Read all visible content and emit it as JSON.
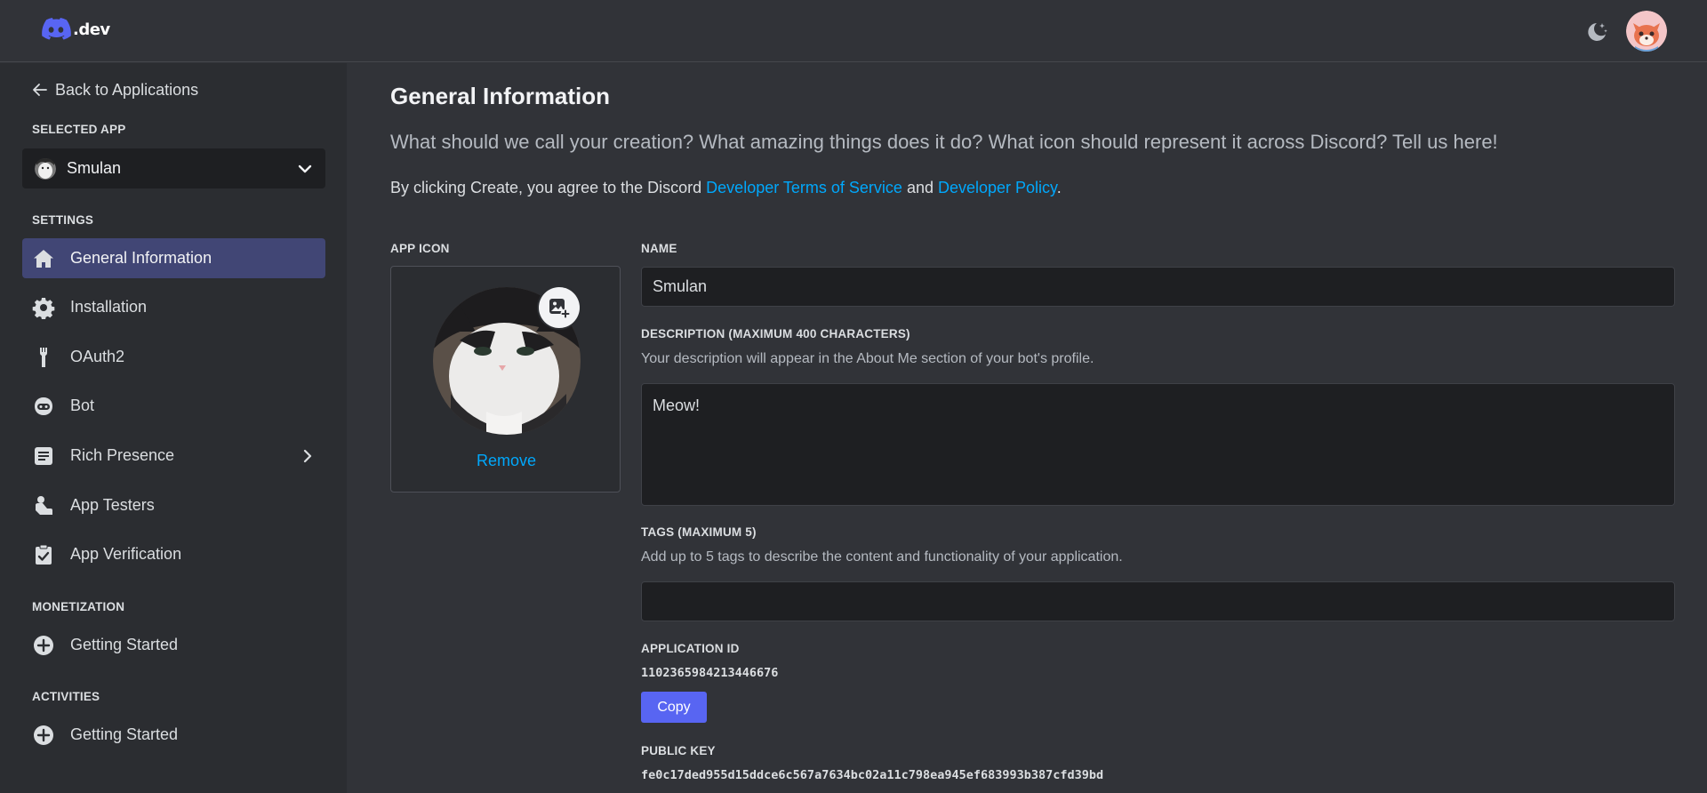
{
  "header": {
    "brand_suffix": ".dev",
    "theme_icon": "moon-sparkle-icon",
    "avatar": "fox-avatar"
  },
  "sidebar": {
    "back_label": "Back to Applications",
    "selected_app_heading": "SELECTED APP",
    "selected_app_name": "Smulan",
    "settings_heading": "SETTINGS",
    "settings_items": [
      {
        "label": "General Information",
        "icon": "home-icon",
        "active": true
      },
      {
        "label": "Installation",
        "icon": "gear-icon"
      },
      {
        "label": "OAuth2",
        "icon": "wrench-icon"
      },
      {
        "label": "Bot",
        "icon": "bot-icon"
      },
      {
        "label": "Rich Presence",
        "icon": "document-icon",
        "has_submenu": true
      },
      {
        "label": "App Testers",
        "icon": "person-icon"
      },
      {
        "label": "App Verification",
        "icon": "clipboard-check-icon"
      }
    ],
    "monetization_heading": "MONETIZATION",
    "monetization_items": [
      {
        "label": "Getting Started",
        "icon": "plus-circle-icon"
      }
    ],
    "activities_heading": "ACTIVITIES",
    "activities_items": [
      {
        "label": "Getting Started",
        "icon": "plus-circle-icon"
      }
    ]
  },
  "main": {
    "title": "General Information",
    "subtitle": "What should we call your creation? What amazing things does it do? What icon should represent it across Discord? Tell us here!",
    "terms_prefix": "By clicking Create, you agree to the Discord ",
    "terms_link_1": "Developer Terms of Service",
    "terms_and": " and ",
    "terms_link_2": "Developer Policy",
    "terms_suffix": ".",
    "app_icon_label": "APP ICON",
    "remove_label": "Remove",
    "name_label": "NAME",
    "name_value": "Smulan",
    "description_label": "DESCRIPTION (MAXIMUM 400 CHARACTERS)",
    "description_help": "Your description will appear in the About Me section of your bot's profile.",
    "description_value": "Meow!",
    "tags_label": "TAGS (MAXIMUM 5)",
    "tags_help": "Add up to 5 tags to describe the content and functionality of your application.",
    "tags_value": "",
    "app_id_label": "APPLICATION ID",
    "app_id_value": "1102365984213446676",
    "copy_label": "Copy",
    "public_key_label": "PUBLIC KEY",
    "public_key_value": "fe0c17ded955d15ddce6c567a7634bc02a11c798ea945ef683993b387cfd39bd"
  },
  "colors": {
    "accent": "#5865f2",
    "link": "#00a8fc",
    "active_nav": "#414675"
  }
}
